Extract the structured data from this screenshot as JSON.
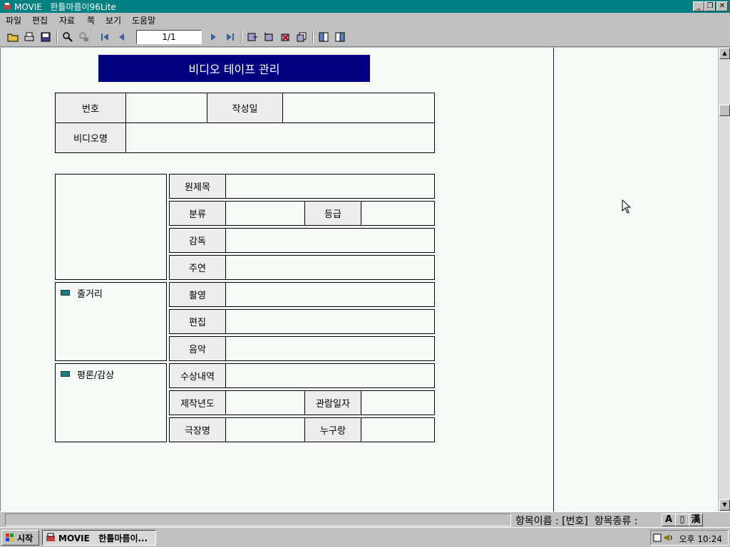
{
  "window": {
    "title": "MOVIE   한틀마름이96Lite",
    "minimize_label": "_",
    "restore_label": "❐",
    "close_label": "✕"
  },
  "menu": [
    "파일",
    "편집",
    "자료",
    "쪽",
    "보기",
    "도움말"
  ],
  "toolbar": {
    "page_indicator": "1/1",
    "icons": [
      "open-folder-icon",
      "print-icon",
      "save-icon",
      "search-icon",
      "find-replace-icon",
      "first-page-icon",
      "prev-page-icon",
      "next-page-icon",
      "last-page-icon",
      "add-record-icon",
      "insert-record-icon",
      "delete-record-icon",
      "copy-record-icon",
      "book-icon",
      "book-open-icon"
    ]
  },
  "form": {
    "title": "비디오 테이프 관리",
    "labels": {
      "number": "번호",
      "date": "작성일",
      "video_name": "비디오명",
      "original_title": "원제목",
      "category": "분류",
      "rating": "등급",
      "director": "감독",
      "cast": "주연",
      "cinematography": "촬영",
      "editing": "편집",
      "music": "음악",
      "awards": "수상내역",
      "production_year": "제작년도",
      "viewing_date": "관람일자",
      "theater": "극장명",
      "companion": "누구랑"
    },
    "groups": {
      "synopsis": "줄거리",
      "review": "평론/감상"
    },
    "values": {
      "number": "",
      "date": "",
      "video_name": "",
      "original_title": "",
      "category": "",
      "rating": "",
      "director": "",
      "cast": "",
      "cinematography": "",
      "editing": "",
      "music": "",
      "awards": "",
      "production_year": "",
      "viewing_date": "",
      "theater": "",
      "companion": ""
    }
  },
  "statusbar": {
    "text": "항목이름 : [번호]  항목종류 :",
    "type_icons": [
      "A",
      "▯",
      "漢"
    ]
  },
  "taskbar": {
    "start_label": "시작",
    "task_label": "MOVIE   한틀마름이...",
    "clock": "오후 10:24"
  },
  "colors": {
    "titlebar": "#008080",
    "form_title_bg": "#000080",
    "page_bg": "#f5faf7",
    "bullet": "#1e7c7c"
  }
}
